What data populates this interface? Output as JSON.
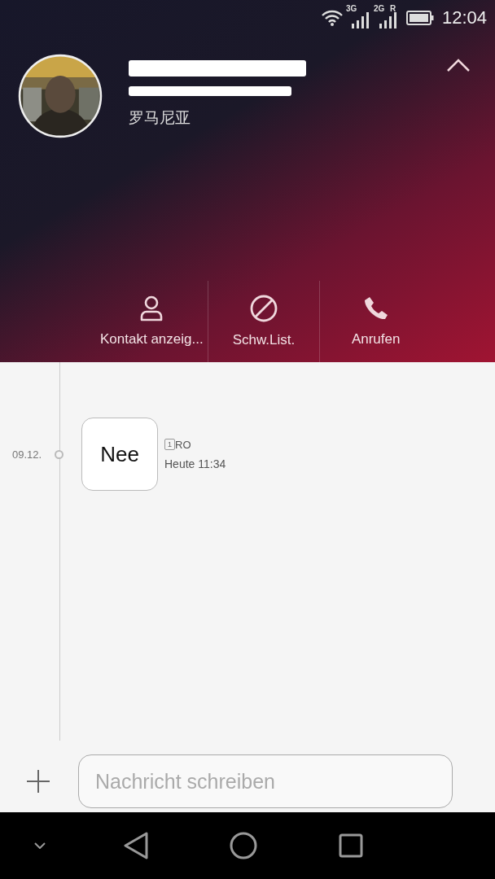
{
  "status_bar": {
    "network_1": "3G",
    "network_2": "2G",
    "roaming": "R",
    "time": "12:04"
  },
  "contact": {
    "name_redacted": true,
    "number_redacted": true,
    "country": "罗马尼亚"
  },
  "actions": [
    {
      "label": "Kontakt anzeig..."
    },
    {
      "label": "Schw.List."
    },
    {
      "label": "Anrufen"
    }
  ],
  "messages": [
    {
      "date": "09.12.",
      "text": "Nee",
      "sim": "1",
      "sim_label": "RO",
      "time": "Heute 11:34"
    }
  ],
  "composer": {
    "placeholder": "Nachricht schreiben"
  }
}
